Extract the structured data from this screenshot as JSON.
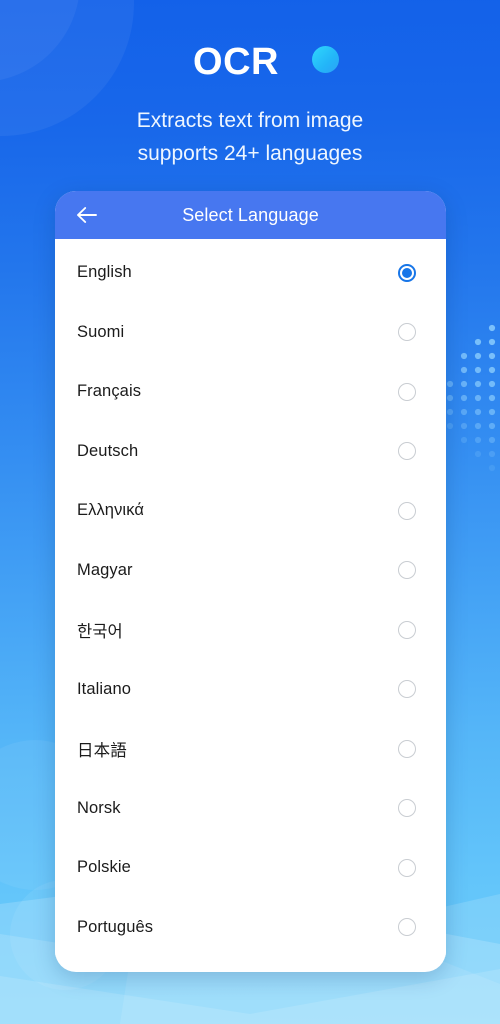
{
  "header": {
    "brand_title": "OCR",
    "brand_dot_icon": "accent-dot-icon",
    "tagline_line1": "Extracts text from image",
    "tagline_line2": "supports 24+ languages"
  },
  "appbar": {
    "back_icon": "back-arrow-icon",
    "title": "Select Language"
  },
  "language_list": {
    "selected": "English",
    "items": [
      {
        "label": "English",
        "selected": true
      },
      {
        "label": "Suomi",
        "selected": false
      },
      {
        "label": "Français",
        "selected": false
      },
      {
        "label": "Deutsch",
        "selected": false
      },
      {
        "label": "Ελληνικά",
        "selected": false
      },
      {
        "label": "Magyar",
        "selected": false
      },
      {
        "label": "한국어",
        "selected": false
      },
      {
        "label": "Italiano",
        "selected": false
      },
      {
        "label": "日本語",
        "selected": false
      },
      {
        "label": "Norsk",
        "selected": false
      },
      {
        "label": "Polskie",
        "selected": false
      },
      {
        "label": "Português",
        "selected": false
      }
    ]
  },
  "colors": {
    "background_top": "#1361e9",
    "background_bottom": "#6dcffb",
    "appbar": "#4777f0",
    "accent_dot": "#2fd8fd",
    "radio_selected": "#1876e8",
    "radio_unselected": "#c9cdd2",
    "card": "#ffffff",
    "list_text": "#1b1b1b"
  },
  "decor": {
    "top_left_circles_icon": "concentric-circles-decoration",
    "dot_grid_icon": "dot-grid-decoration",
    "bottom_waves_icon": "wave-decoration"
  }
}
